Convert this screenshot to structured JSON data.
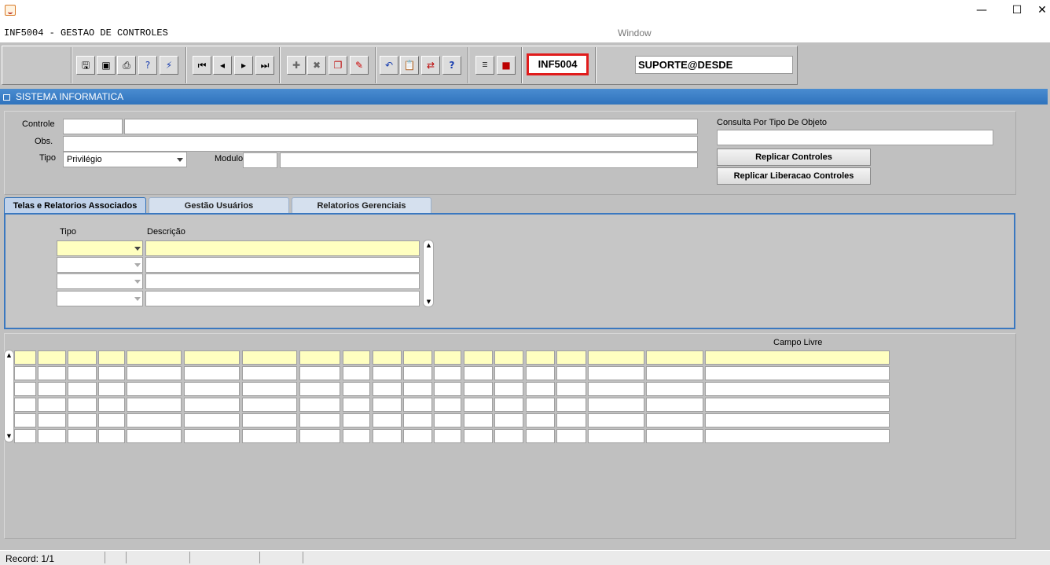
{
  "window": {
    "title": "INF5004 - GESTAO DE CONTROLES",
    "menu": "Window",
    "min": "—",
    "max": "☐",
    "close": "✕"
  },
  "toolbar": {
    "icons": [
      "save-icon",
      "print-preview-icon",
      "printer-icon",
      "help-query-icon",
      "execute-query-icon",
      "first-record-icon",
      "previous-record-icon",
      "next-record-icon",
      "last-record-icon",
      "insert-record-icon",
      "delete-record-icon",
      "duplicate-record-icon",
      "clear-record-icon",
      "undo-icon",
      "clipboard-icon",
      "transfer-icon",
      "help-icon",
      "menu-icon",
      "exit-icon"
    ],
    "form_code": "INF5004",
    "user": "SUPORTE@DESDE"
  },
  "section": {
    "title": "SISTEMA INFORMATICA"
  },
  "header_form": {
    "controle_label": "Controle",
    "controle_code": "",
    "controle_desc": "",
    "obs_label": "Obs.",
    "obs_value": "",
    "tipo_label": "Tipo",
    "tipo_value": "Privilégio",
    "modulo_label": "Modulo",
    "modulo_code": "",
    "modulo_desc": "",
    "consulta_label": "Consulta Por Tipo De Objeto",
    "consulta_value": "",
    "replicar_controles": "Replicar Controles",
    "replicar_liberacao": "Replicar Liberacao Controles"
  },
  "tabs": [
    {
      "label": "Telas e Relatorios Associados",
      "active": true
    },
    {
      "label": "Gestão Usuários",
      "active": false
    },
    {
      "label": "Relatorios Gerenciais",
      "active": false
    }
  ],
  "assoc_table": {
    "col_tipo": "Tipo",
    "col_descricao": "Descrição",
    "rows": [
      {
        "tipo": "",
        "descricao": ""
      },
      {
        "tipo": "",
        "descricao": ""
      },
      {
        "tipo": "",
        "descricao": ""
      },
      {
        "tipo": "",
        "descricao": ""
      }
    ]
  },
  "grid": {
    "campo_livre_label": "Campo Livre",
    "row_count": 6
  },
  "status": {
    "record": "Record: 1/1"
  }
}
